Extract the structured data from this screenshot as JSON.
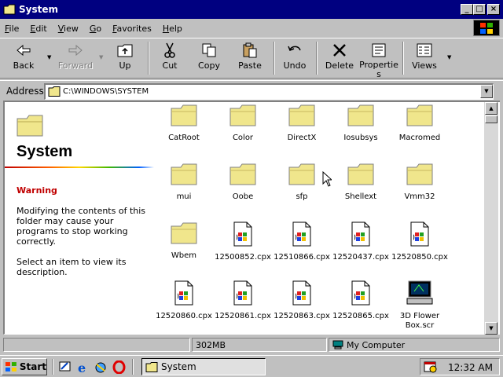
{
  "window": {
    "title": "System"
  },
  "menu": [
    "File",
    "Edit",
    "View",
    "Go",
    "Favorites",
    "Help"
  ],
  "toolbar": {
    "back": "Back",
    "forward": "Forward",
    "up": "Up",
    "cut": "Cut",
    "copy": "Copy",
    "paste": "Paste",
    "undo": "Undo",
    "delete": "Delete",
    "properties_1": "Propertie",
    "properties_2": "s",
    "views": "Views"
  },
  "address": {
    "label": "Address",
    "path": "C:\\WINDOWS\\SYSTEM"
  },
  "left_panel": {
    "title": "System",
    "warning": "Warning",
    "text1": "Modifying the contents of this folder may cause your programs to stop working correctly.",
    "text2": "Select an item to view its description."
  },
  "items": [
    {
      "label": "CatRoot",
      "type": "folder"
    },
    {
      "label": "Color",
      "type": "folder"
    },
    {
      "label": "DirectX",
      "type": "folder"
    },
    {
      "label": "Iosubsys",
      "type": "folder"
    },
    {
      "label": "Macromed",
      "type": "folder"
    },
    {
      "label": "mui",
      "type": "folder"
    },
    {
      "label": "Oobe",
      "type": "folder"
    },
    {
      "label": "sfp",
      "type": "folder"
    },
    {
      "label": "Shellext",
      "type": "folder"
    },
    {
      "label": "Vmm32",
      "type": "folder"
    },
    {
      "label": "Wbem",
      "type": "folder"
    },
    {
      "label": "12500852.cpx",
      "type": "cpx"
    },
    {
      "label": "12510866.cpx",
      "type": "cpx"
    },
    {
      "label": "12520437.cpx",
      "type": "cpx"
    },
    {
      "label": "12520850.cpx",
      "type": "cpx"
    },
    {
      "label": "12520860.cpx",
      "type": "cpx"
    },
    {
      "label": "12520861.cpx",
      "type": "cpx"
    },
    {
      "label": "12520863.cpx",
      "type": "cpx"
    },
    {
      "label": "12520865.cpx",
      "type": "cpx"
    },
    {
      "label": "3D Flower Box.scr",
      "label_line1": "3D Flower",
      "label_line2": "Box.scr",
      "type": "scr"
    }
  ],
  "status": {
    "size": "302MB",
    "zone": "My Computer"
  },
  "taskbar": {
    "start": "Start",
    "task": "System",
    "clock": "12:32 AM"
  },
  "colors": {
    "titlebar": "#000080",
    "chrome": "#c0c0c0",
    "warning": "#c00000",
    "folder": "#f0e68c"
  }
}
